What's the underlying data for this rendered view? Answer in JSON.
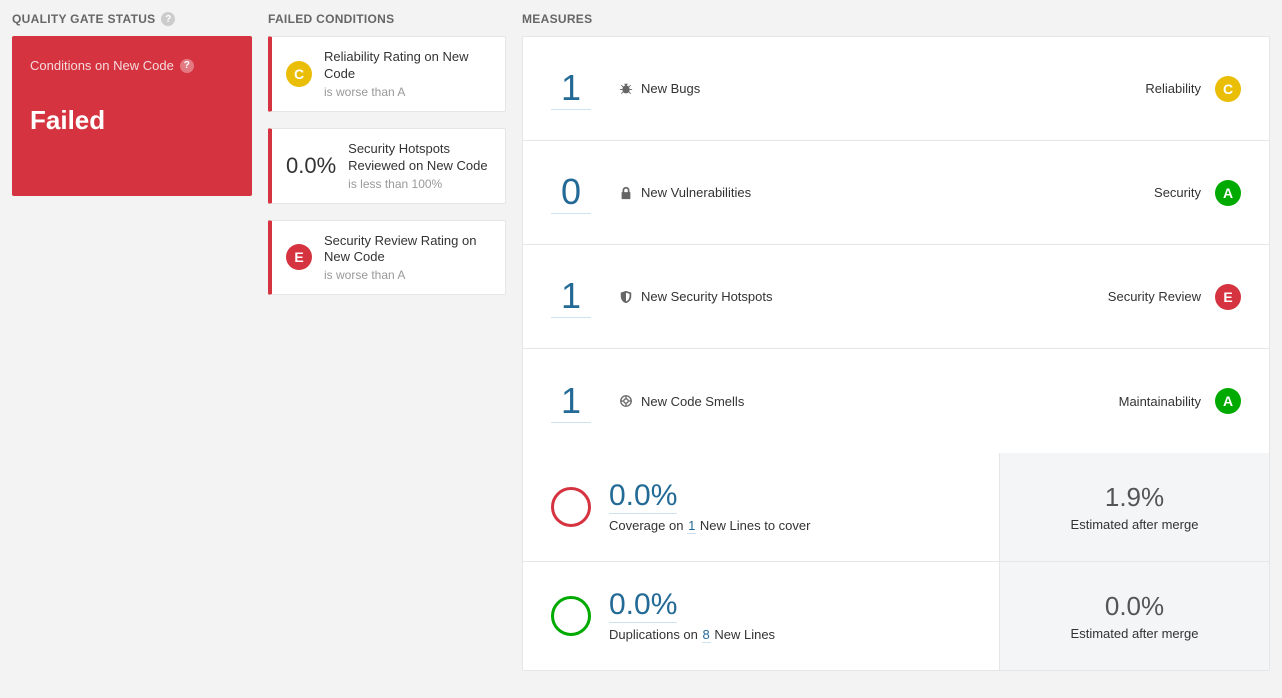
{
  "sections": {
    "quality_gate_title": "QUALITY GATE STATUS",
    "failed_conditions_title": "FAILED CONDITIONS",
    "measures_title": "MEASURES"
  },
  "quality_gate": {
    "conditions_label": "Conditions on New Code",
    "status": "Failed"
  },
  "failed_conditions": [
    {
      "badge_type": "rating",
      "rating": "C",
      "title": "Reliability Rating on New Code",
      "sub": "is worse than A"
    },
    {
      "badge_type": "value",
      "value": "0.0%",
      "title": "Security Hotspots Reviewed on New Code",
      "sub": "is less than 100%"
    },
    {
      "badge_type": "rating",
      "rating": "E",
      "title": "Security Review Rating on New Code",
      "sub": "is worse than A"
    }
  ],
  "measures": [
    {
      "value": "1",
      "icon": "bug",
      "label": "New Bugs",
      "category": "Reliability",
      "rating": "C"
    },
    {
      "value": "0",
      "icon": "lock",
      "label": "New Vulnerabilities",
      "category": "Security",
      "rating": "A"
    },
    {
      "value": "1",
      "icon": "shield",
      "label": "New Security Hotspots",
      "category": "Security Review",
      "rating": "E"
    },
    {
      "value": "1",
      "icon": "smell",
      "label": "New Code Smells",
      "category": "Maintainability",
      "rating": "A"
    }
  ],
  "coverage": {
    "value": "0.0%",
    "sub_prefix": "Coverage on ",
    "sub_num": "1",
    "sub_suffix": " New Lines to cover",
    "est_value": "1.9%",
    "est_label": "Estimated after merge"
  },
  "duplications": {
    "value": "0.0%",
    "sub_prefix": "Duplications on ",
    "sub_num": "8",
    "sub_suffix": " New Lines",
    "est_value": "0.0%",
    "est_label": "Estimated after merge"
  }
}
